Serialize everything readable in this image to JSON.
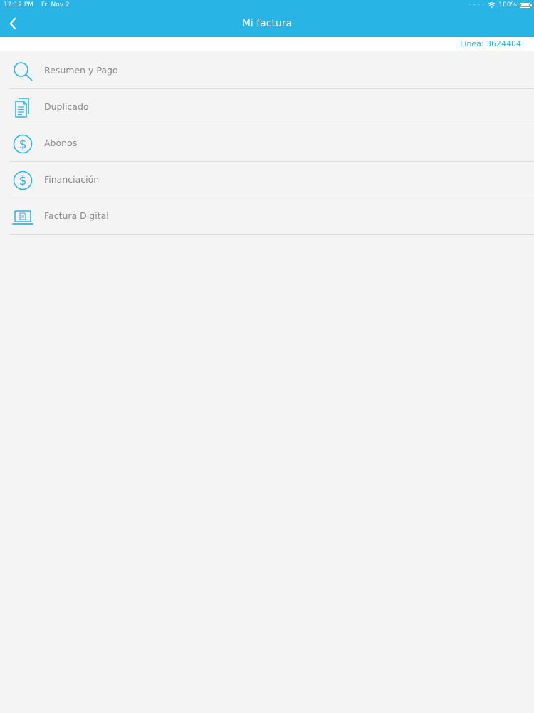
{
  "status_bar": {
    "time": "12:12 PM",
    "date": "Fri Nov 2",
    "battery": "100%",
    "battery_level": 1.0,
    "wifi_icon": "wifi-icon",
    "battery_icon": "battery-icon"
  },
  "nav": {
    "title": "Mi factura",
    "back_icon": "chevron-left-icon"
  },
  "line": {
    "text": "Línea: 3624404"
  },
  "menu": {
    "items": [
      {
        "label": "Resumen y Pago",
        "icon": "search-icon"
      },
      {
        "label": "Duplicado",
        "icon": "document-copy-icon"
      },
      {
        "label": "Abonos",
        "icon": "dollar-circle-icon"
      },
      {
        "label": "Financiación",
        "icon": "dollar-circle-icon"
      },
      {
        "label": "Factura Digital",
        "icon": "laptop-document-icon"
      }
    ]
  },
  "colors": {
    "accent": "#29b4e6",
    "background": "#f5f4f4",
    "text_gray": "#8a8a8a",
    "divider": "#dcdcdc"
  }
}
